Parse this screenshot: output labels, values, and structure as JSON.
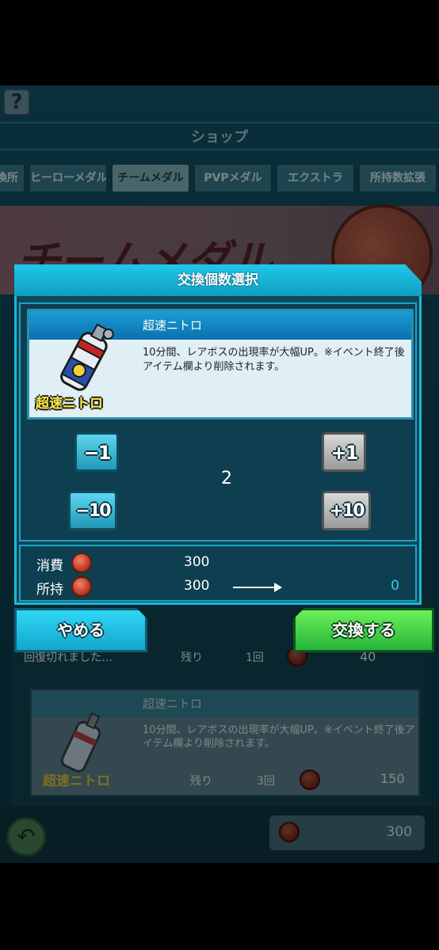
{
  "background": {
    "title": "ショップ",
    "help": "?",
    "tabs": [
      "換所",
      "ヒーローメダル",
      "チームメダル",
      "PVPメダル",
      "エクストラ",
      "所持数拡張"
    ],
    "active_tab": "チームメダル",
    "banner_text": "チームメダル",
    "list_rows": [
      {
        "status": "回復切れました…",
        "remaining_label": "残り",
        "remaining": "1回",
        "price": "40"
      }
    ],
    "card": {
      "name": "超速ニトロ",
      "description": "10分間、レアボスの出現率が大幅UP。※イベント終了後アイテム欄より削除されます。",
      "label": "超速ニトロ",
      "remaining_label": "残り",
      "remaining": "3回",
      "price": "150"
    },
    "coin_total": "300"
  },
  "modal": {
    "title": "交換個数選択",
    "item": {
      "name": "超速ニトロ",
      "description": "10分間、レアボスの出現率が大幅UP。※イベント終了後アイテム欄より削除されます。",
      "label": "超速ニトロ"
    },
    "buttons": {
      "minus1": "−1",
      "plus1": "+1",
      "minus10": "−10",
      "plus10": "+10"
    },
    "quantity": "2",
    "cost": {
      "consume_label": "消費",
      "consume_value": "300",
      "owned_label": "所持",
      "owned_value": "300",
      "owned_after": "0"
    },
    "cancel_label": "やめる",
    "confirm_label": "交換する"
  },
  "colors": {
    "accent": "#1cb8d8",
    "confirm": "#3cc845",
    "after_value": "#3bc7ef"
  }
}
